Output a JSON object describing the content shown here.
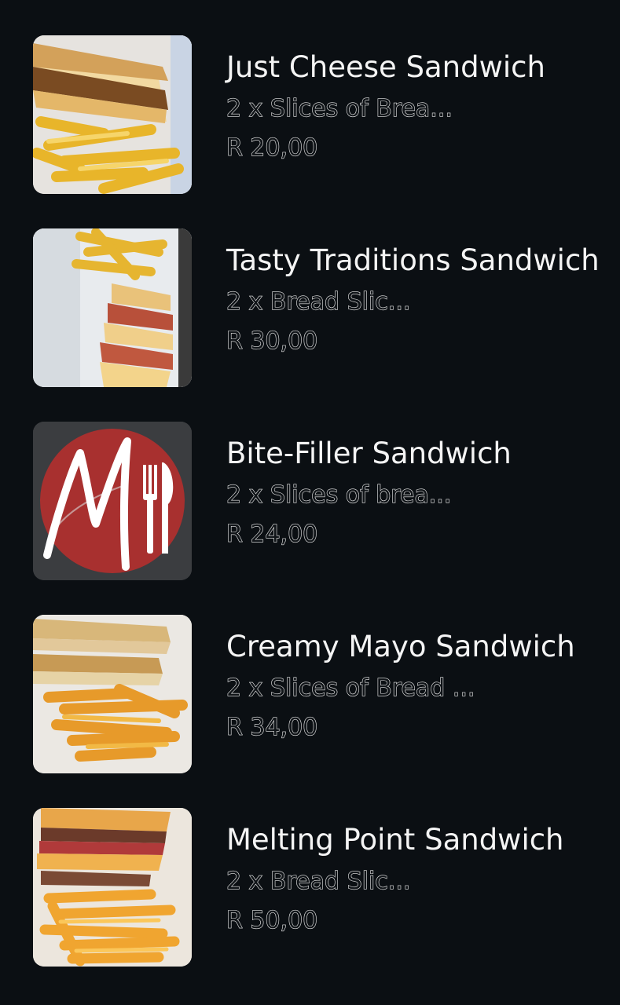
{
  "menu": {
    "items": [
      {
        "name": "Just Cheese Sandwich",
        "description": "2 x Slices of Brea...",
        "price": "R 20,00",
        "image": "toasted-sandwich-with-fries-image"
      },
      {
        "name": "Tasty Traditions Sandwich",
        "description": "2 x Bread Slic...",
        "price": "R 30,00",
        "image": "sandwich-and-fries-in-container-image"
      },
      {
        "name": "Bite-Filler Sandwich",
        "description": "2 x Slices of brea...",
        "price": "R 24,00",
        "image": "restaurant-logo-image"
      },
      {
        "name": "Creamy Mayo Sandwich",
        "description": "2 x Slices of Bread ...",
        "price": "R 34,00",
        "image": "toasted-sandwich-with-fries-image"
      },
      {
        "name": "Melting Point Sandwich",
        "description": "2 x Bread Slic...",
        "price": "R 50,00",
        "image": "toasted-sandwich-with-fries-image"
      }
    ]
  },
  "colors": {
    "background": "#0b0f13",
    "title_text": "#f4f4f4",
    "logo_red": "#a8302f",
    "logo_bg": "#3b3d40"
  }
}
